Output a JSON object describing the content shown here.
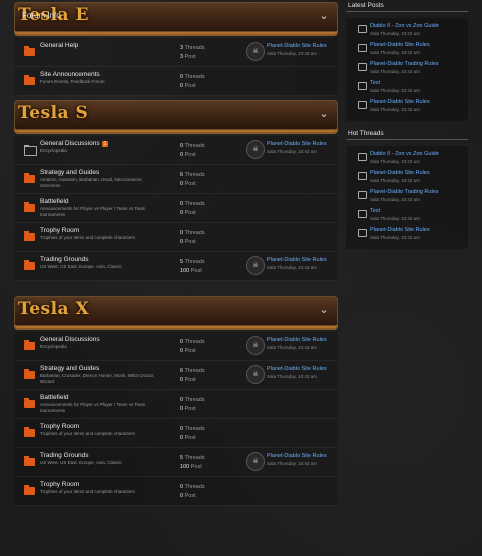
{
  "categories": [
    {
      "title": "Tesla E",
      "subtitle": "Forum Info",
      "forums": [
        {
          "title": "General Help",
          "desc": "",
          "threads": "3",
          "posts": "3",
          "last_title": "Planet-Diablo Site Rules",
          "last_date": "Sala Thursday, 10:43 am",
          "has_last": true,
          "icon": "folder"
        },
        {
          "title": "Site Announcements",
          "desc": "Forum Events, Feedback Forum",
          "threads": "0",
          "posts": "0",
          "last_title": "",
          "last_date": "",
          "has_last": false,
          "icon": "folder"
        }
      ]
    },
    {
      "title": "Tesla S",
      "subtitle": "",
      "forums": [
        {
          "title": "General Discussions",
          "badge": "1",
          "desc": "Encyclopedia",
          "threads": "0",
          "posts": "0",
          "last_title": "Planet-Diablo Site Rules",
          "last_date": "Sala Thursday, 10:43 am",
          "has_last": true,
          "icon": "empty"
        },
        {
          "title": "Strategy and Guides",
          "desc": "Amazon, Assassin, Barbarian, Druid, Necromancer, Sorceress",
          "threads": "6",
          "posts": "0",
          "last_title": "",
          "last_date": "",
          "has_last": false,
          "icon": "folder"
        },
        {
          "title": "Battlefield",
          "desc": "Announcements for Player vs Player / Team vs Team tournaments",
          "threads": "0",
          "posts": "0",
          "last_title": "",
          "last_date": "",
          "has_last": false,
          "icon": "folder"
        },
        {
          "title": "Trophy Room",
          "desc": "Trophies of your items and complete characters",
          "threads": "0",
          "posts": "0",
          "last_title": "",
          "last_date": "",
          "has_last": false,
          "icon": "folder"
        },
        {
          "title": "Trading Grounds",
          "desc": "US West, US East, Europe, Asia, Classic",
          "threads": "5",
          "posts": "100",
          "last_title": "Planet-Diablo Site Rules",
          "last_date": "Sala Thursday, 10:43 am",
          "has_last": true,
          "icon": "folder"
        }
      ]
    },
    {
      "title": "Tesla X",
      "subtitle": "",
      "forums": [
        {
          "title": "General Discussions",
          "desc": "Encyclopedia",
          "threads": "0",
          "posts": "0",
          "last_title": "Planet-Diablo Site Rules",
          "last_date": "Sala Thursday, 10:43 am",
          "has_last": true,
          "icon": "folder"
        },
        {
          "title": "Strategy and Guides",
          "desc": "Barbarian, Crusader, Demon Hunter, Monk, Witch Doctor, Wizard",
          "threads": "6",
          "posts": "0",
          "last_title": "Planet-Diablo Site Rules",
          "last_date": "Sala Thursday, 10:43 am",
          "has_last": true,
          "icon": "folder"
        },
        {
          "title": "Battlefield",
          "desc": "Announcements for Player vs Player / Team vs Team tournaments",
          "threads": "0",
          "posts": "0",
          "last_title": "",
          "last_date": "",
          "has_last": false,
          "icon": "folder"
        },
        {
          "title": "Trophy Room",
          "desc": "Trophies of your items and complete characters",
          "threads": "0",
          "posts": "0",
          "last_title": "",
          "last_date": "",
          "has_last": false,
          "icon": "folder"
        },
        {
          "title": "Trading Grounds",
          "desc": "US West, US East, Europe, Asia, Classic",
          "threads": "5",
          "posts": "100",
          "last_title": "Planet-Diablo Site Rules",
          "last_date": "Sala Thursday, 10:43 am",
          "has_last": true,
          "icon": "folder"
        },
        {
          "title": "Trophy Room",
          "desc": "Trophies of your items and complete characters",
          "threads": "0",
          "posts": "0",
          "last_title": "",
          "last_date": "",
          "has_last": false,
          "icon": "folder"
        }
      ]
    }
  ],
  "labels": {
    "threads": "Threads",
    "posts": "Post"
  },
  "sidebar": {
    "latest_title": "Latest Posts",
    "latest": [
      {
        "title": "Diablo II - Zon vs Zon Guide",
        "date": "Sala Thursday, 10:43 am"
      },
      {
        "title": "Planet-Diablo Site Rules",
        "date": "Sala Thursday, 10:43 am"
      },
      {
        "title": "Planet-Diablo Trading Rules",
        "date": "Sala Thursday, 10:43 am"
      },
      {
        "title": "Test",
        "date": "Sala Thursday, 10:43 am"
      },
      {
        "title": "Planet-Diablo Site Rules",
        "date": "Sala Thursday, 10:43 am"
      }
    ],
    "hot_title": "Hot Threads",
    "hot": [
      {
        "title": "Diablo II - Zon vs Zon Guide",
        "date": "Sala Thursday, 10:43 am"
      },
      {
        "title": "Planet-Diablo Site Rules",
        "date": "Sala Thursday, 10:43 am"
      },
      {
        "title": "Planet-Diablo Trading Rules",
        "date": "Sala Thursday, 10:43 am"
      },
      {
        "title": "Test",
        "date": "Sala Thursday, 10:43 am"
      },
      {
        "title": "Planet-Diablo Site Rules",
        "date": "Sala Thursday, 10:43 am"
      }
    ]
  },
  "colors": {
    "accent": "#e2a43a",
    "link": "#6ab0ff",
    "folder": "#e05a1a"
  }
}
